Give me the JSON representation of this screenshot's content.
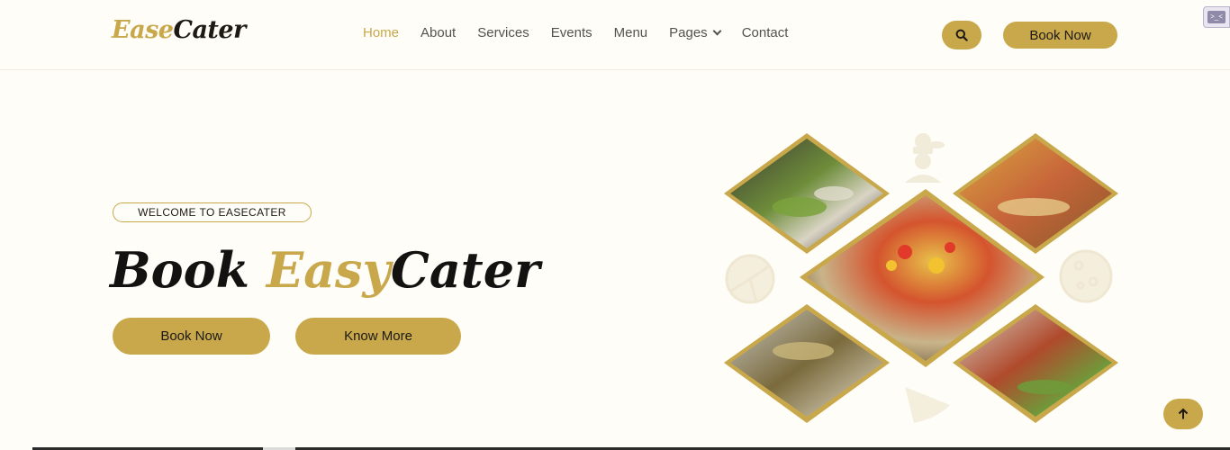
{
  "brand": {
    "part1": "Ease",
    "part2": "Cater"
  },
  "nav": {
    "items": [
      "Home",
      "About",
      "Services",
      "Events",
      "Menu",
      "Pages",
      "Contact"
    ],
    "active": "Home"
  },
  "header": {
    "book_label": "Book Now"
  },
  "hero": {
    "welcome": "WELCOME TO EASECATER",
    "title_part1": "Book ",
    "title_accent": "Easy",
    "title_part2": "Cater",
    "book_label": "Book Now",
    "more_label": "Know More"
  },
  "colors": {
    "accent": "#c8a84a",
    "background": "#fefdf8",
    "text": "#1d1a14"
  },
  "icons": [
    "search-icon",
    "chevron-down-icon",
    "arrow-up-icon",
    "chef-icon",
    "pizza-icon",
    "pizza-slice-icon"
  ]
}
